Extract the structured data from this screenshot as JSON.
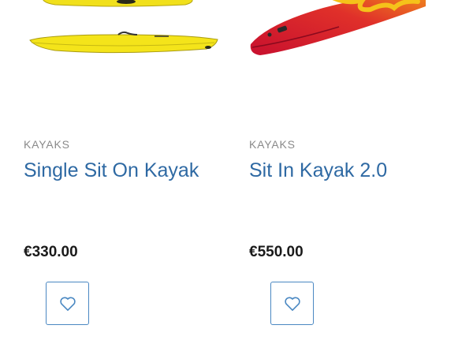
{
  "products": [
    {
      "category": "KAYAKS",
      "title": "Single Sit On Kayak",
      "price": "€330.00",
      "image_icon": "yellow-kayak",
      "wishlist_icon": "heart-outline-icon"
    },
    {
      "category": "KAYAKS",
      "title": "Sit In Kayak 2.0",
      "price": "€550.00",
      "image_icon": "red-kayak",
      "wishlist_icon": "heart-outline-icon"
    }
  ],
  "colors": {
    "title": "#2e69a3",
    "category": "#8a8a8a",
    "price": "#1a1a1a",
    "wishlist_border": "#4a88c2",
    "kayak_yellow": "#f4e41a",
    "kayak_red": "#d91e2e"
  }
}
